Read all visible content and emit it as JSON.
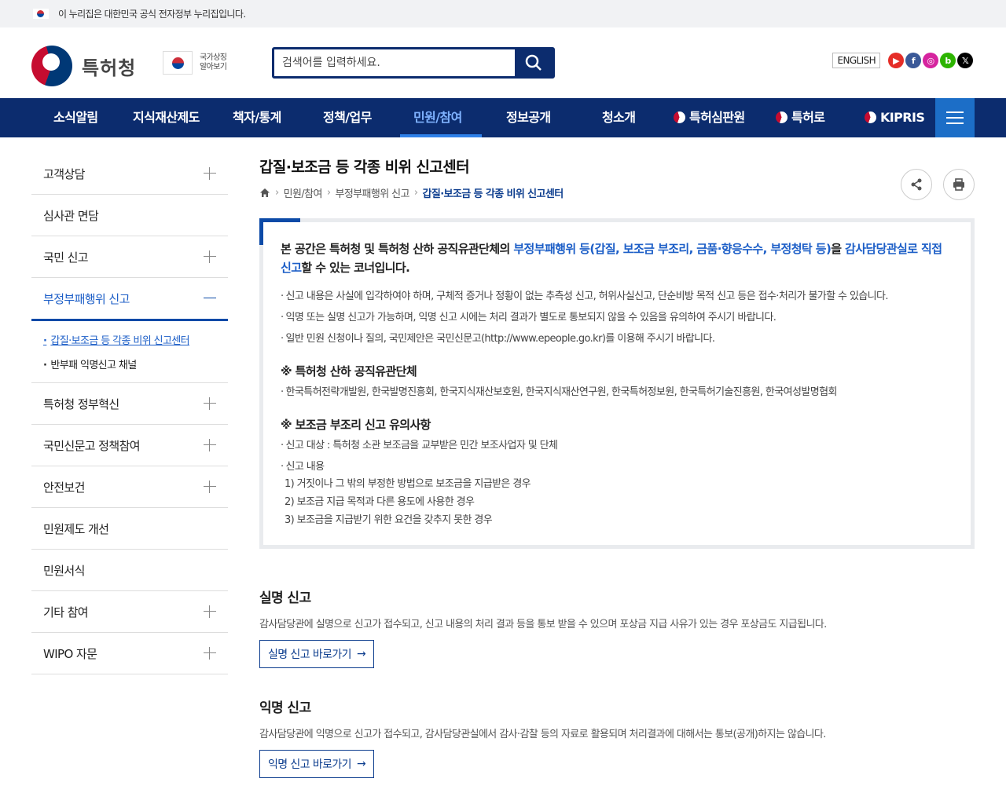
{
  "gov_banner": "이 누리집은 대한민국 공식 전자정부 누리집입니다.",
  "header": {
    "logo_text": "특허청",
    "symbol_line1": "국가상징",
    "symbol_line2": "알아보기",
    "search_placeholder": "검색어를 입력하세요.",
    "english_label": "ENGLISH",
    "sns": [
      {
        "name": "youtube",
        "glyph": "▶",
        "color": "#e52d27"
      },
      {
        "name": "facebook",
        "glyph": "f",
        "color": "#3b5998"
      },
      {
        "name": "instagram",
        "glyph": "◎",
        "color": "#d6249f"
      },
      {
        "name": "blog",
        "glyph": "b",
        "color": "#2db400"
      },
      {
        "name": "x",
        "glyph": "𝕏",
        "color": "#000000"
      }
    ]
  },
  "nav": {
    "items": [
      "소식알림",
      "지식재산제도",
      "책자/통계",
      "정책/업무",
      "민원/참여",
      "정보공개",
      "청소개",
      "특허심판원",
      "특허로",
      "KIPRIS"
    ],
    "active": "민원/참여"
  },
  "sidebar": {
    "items": [
      "고객상담",
      "심사관 면담",
      "국민 신고",
      "부정부패행위 신고",
      "특허청 정부혁신",
      "국민신문고 정책참여",
      "안전보건",
      "민원제도 개선",
      "민원서식",
      "기타 참여",
      "WIPO 자문"
    ],
    "sub_items": [
      "갑질·보조금 등 각종 비위 신고센터",
      "반부패 익명신고 채널"
    ]
  },
  "content": {
    "title": "갑질·보조금 등 각종 비위 신고센터",
    "breadcrumb": [
      "민원/참여",
      "부정부패행위 신고",
      "갑질·보조금 등 각종 비위 신고센터"
    ],
    "lead_parts": [
      "본 공간은 특허청 및 특허청 산하 공직유관단체의 ",
      "부정부패행위 등(갑질, 보조금 부조리, 금품·향응수수, 부정청탁 등)",
      "을 ",
      "감사담당관실로 직접 신고",
      "할 수 있는 코너입니다."
    ],
    "bullets": [
      "신고 내용은 사실에 입각하여야 하며, 구체적 증거나 정황이 없는 추측성 신고, 허위사실신고, 단순비방 목적 신고 등은 접수·처리가 불가할 수 있습니다.",
      "익명 또는 실명 신고가 가능하며, 익명 신고 시에는 처리 결과가 별도로 통보되지 않을 수 있음을 유의하여 주시기 바랍니다.",
      "일반 민원 신청이나 질의, 국민제안은 국민신문고(http://www.epeople.go.kr)를 이용해 주시기 바랍니다."
    ],
    "org_heading": "※ 특허청 산하 공직유관단체",
    "org_list": "한국특허전략개발원, 한국발명진흥회, 한국지식재산보호원, 한국지식재산연구원, 한국특허정보원, 한국특허기술진흥원, 한국여성발명협회",
    "subsidy_heading": "※ 보조금 부조리 신고 유의사항",
    "subsidy_target": "신고 대상 : 특허청 소관 보조금을 교부받은 민간 보조사업자 및 단체",
    "subsidy_content_label": "신고 내용",
    "subsidy_items": [
      "1) 거짓이나 그 밖의 부정한 방법으로 보조금을 지급받은 경우",
      "2) 보조금 지급 목적과 다른 용도에 사용한 경우",
      "3) 보조금을 지급받기 위한 요건을 갖추지 못한 경우"
    ],
    "real_name": {
      "title": "실명 신고",
      "desc": "감사담당관에 실명으로 신고가 접수되고, 신고 내용의 처리 결과 등을 통보 받을 수 있으며 포상금 지급 사유가 있는 경우 포상금도 지급됩니다.",
      "button": "실명 신고 바로가기"
    },
    "anonymous": {
      "title": "익명 신고",
      "desc": "감사담당관에 익명으로 신고가 접수되고, 감사담당관실에서 감사·감찰 등의 자료로 활용되며 처리결과에 대해서는 통보(공개)하지는 않습니다.",
      "button": "익명 신고 바로가기"
    }
  }
}
